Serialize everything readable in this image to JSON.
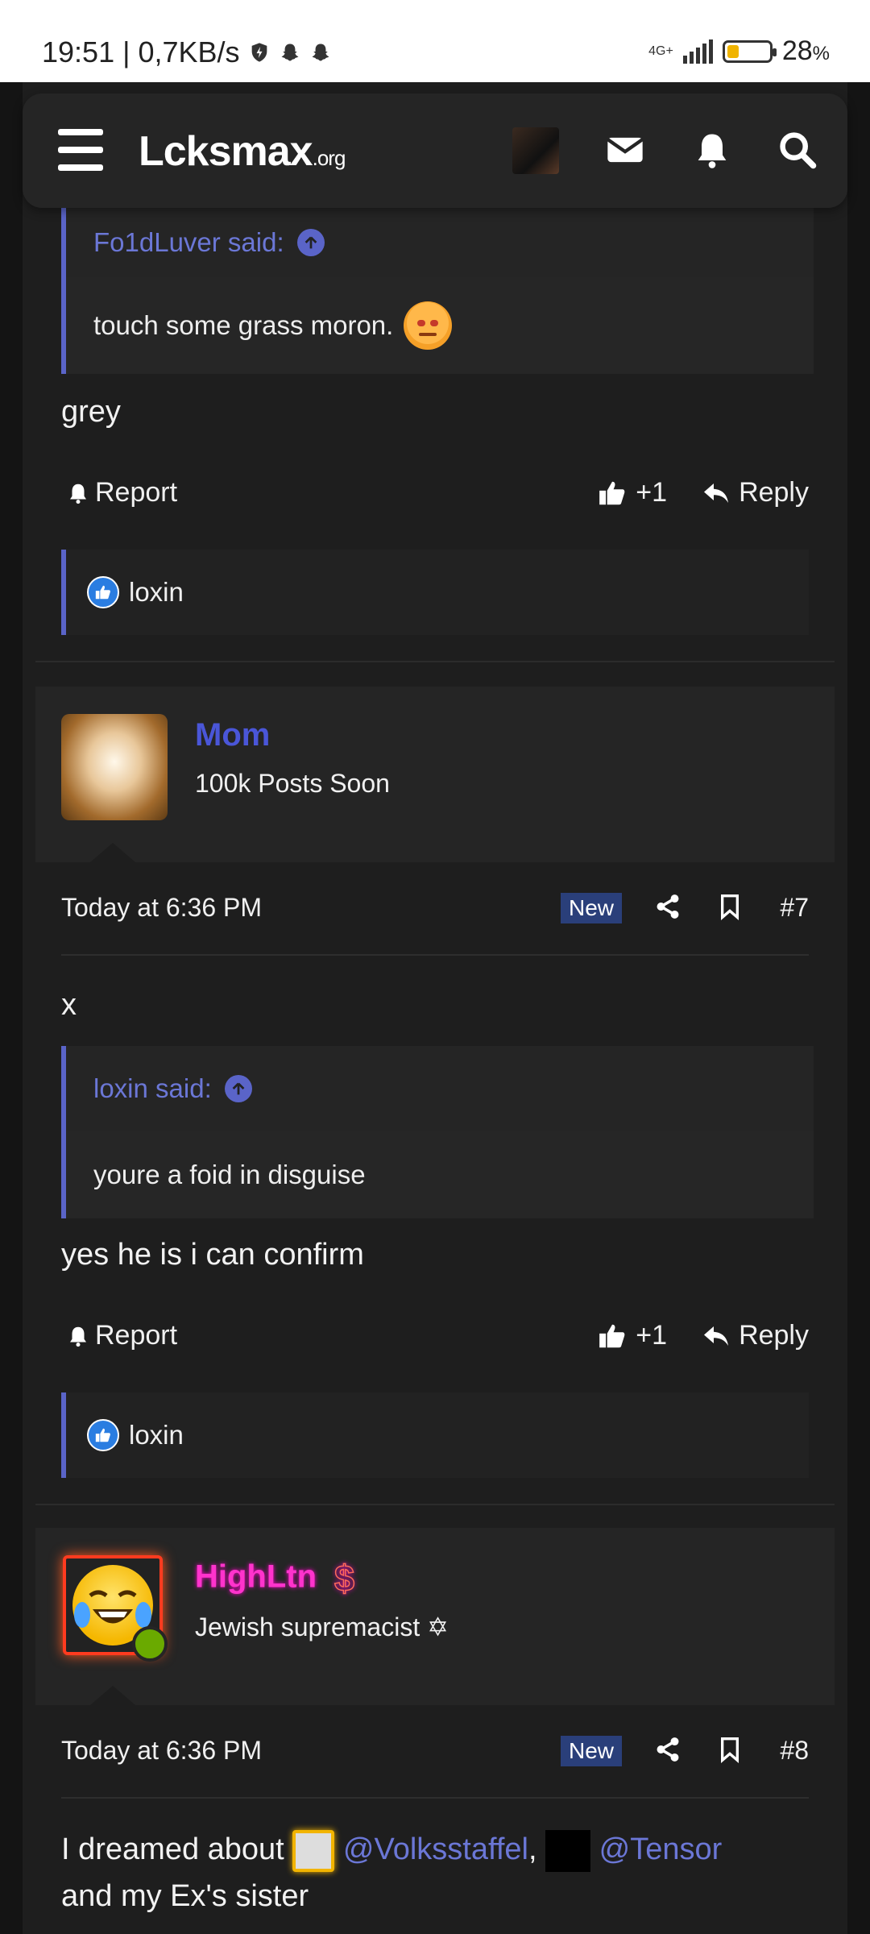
{
  "status_bar": {
    "time": "19:51",
    "speed": "| 0,7KB/s",
    "network": "4G+",
    "battery": "28",
    "battery_unit": "%",
    "battery_level": 0.28
  },
  "navbar": {
    "logo": "Lcksmax",
    "logo_suffix": ".org"
  },
  "post6": {
    "quote_author": "Fo1dLuver said:",
    "quote_text": "touch some grass moron.",
    "body": "grey",
    "report": "Report",
    "like_count": "+1",
    "reply": "Reply",
    "reaction_user": "loxin"
  },
  "post7": {
    "username": "Mom",
    "user_title": "100k Posts Soon",
    "time": "Today at 6:36 PM",
    "new_badge": "New",
    "number": "#7",
    "first_line": "x",
    "quote_author": "loxin said:",
    "quote_text": "youre a foid in disguise",
    "body": "yes he is i can confirm",
    "report": "Report",
    "like_count": "+1",
    "reply": "Reply",
    "reaction_user": "loxin"
  },
  "post8": {
    "username": "HighLtn",
    "user_title": "Jewish supremacist ✡",
    "time": "Today at 6:36 PM",
    "new_badge": "New",
    "number": "#8",
    "body_start": "I dreamed about ",
    "mention1": "@Volksstaffel",
    "comma": ", ",
    "mention2": "@Tensor",
    "body_end": "and my Ex's sister"
  },
  "colors": {
    "accent": "#5a64c8",
    "link": "#6b77d6",
    "username_mom": "#4a56d8",
    "username_highltn": "#ff33cc",
    "new_badge": "#2a3f7a"
  }
}
